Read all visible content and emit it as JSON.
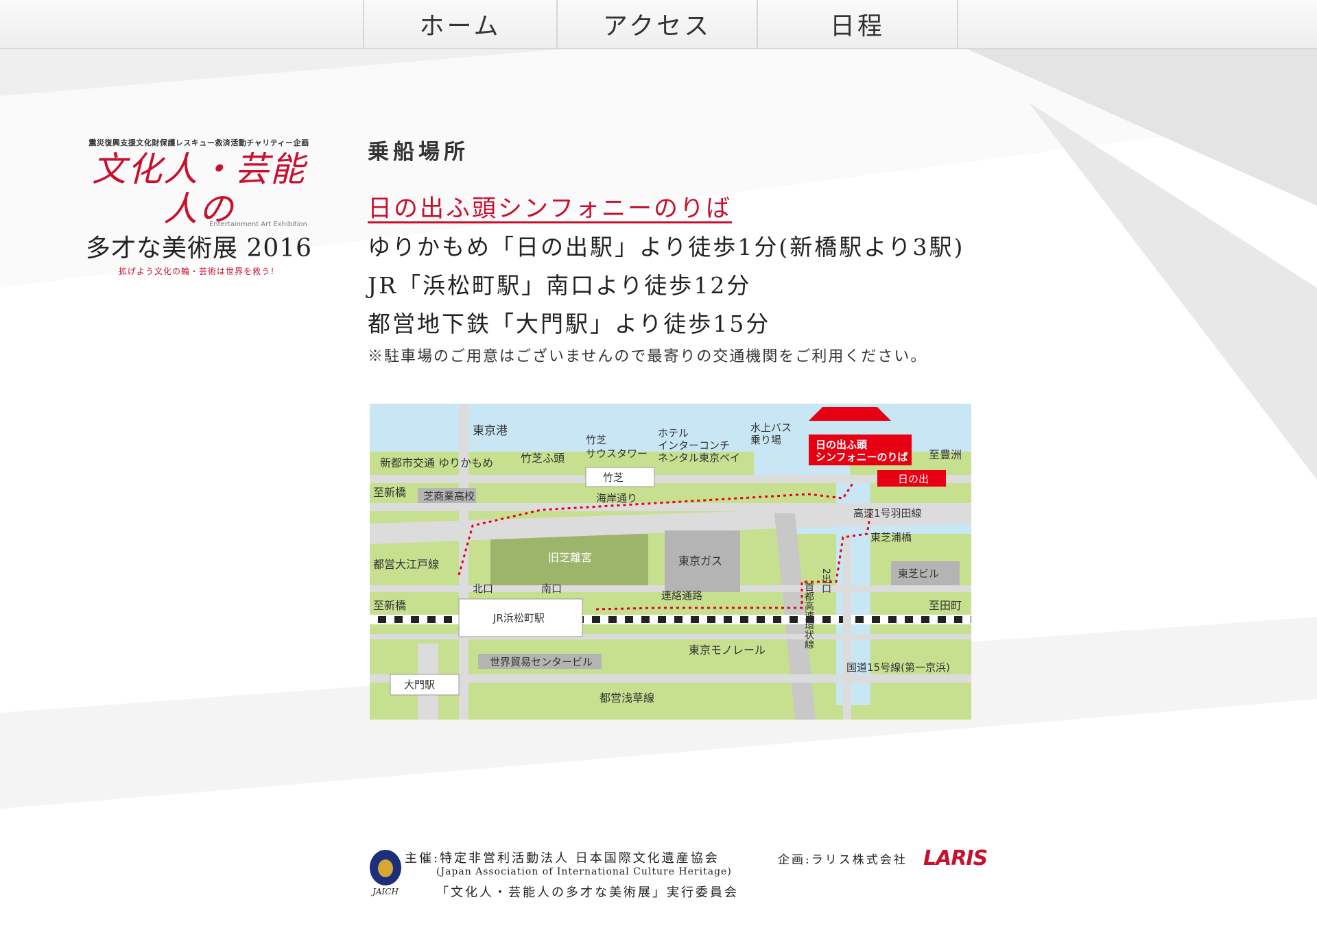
{
  "nav": {
    "items": [
      {
        "label": "ホーム"
      },
      {
        "label": "アクセス"
      },
      {
        "label": "日程"
      }
    ]
  },
  "logo": {
    "pre_title": "震災復興支援文化財保護レスキュー救済活動チャリティー企画",
    "brush_title": "文化人・芸能人の",
    "english": "Entertainment Art Exhibition",
    "main_title": "多才な美術展 2016",
    "tagline": "拡げよう文化の輪・芸術は世界を救う！"
  },
  "content": {
    "heading": "乗船場所",
    "venue": "日の出ふ頭シンフォニーのりば",
    "lines": [
      "ゆりかもめ「日の出駅」より徒歩1分(新橋駅より3駅)",
      "JR「浜松町駅」南口より徒歩12分",
      "都営地下鉄「大門駅」より徒歩15分"
    ],
    "note": "※駐車場のご用意はございませんので最寄りの交通機関をご利用ください。"
  },
  "map": {
    "labels": {
      "tokyo_port": "東京港",
      "yurikamome": "新都市交通 ゆりかもめ",
      "takeshiba_futo": "竹芝ふ頭",
      "takeshiba_tower_1": "竹芝",
      "takeshiba_tower_2": "サウスタワー",
      "hotel_1": "ホテル",
      "hotel_2": "インターコンチ",
      "hotel_3": "ネンタル東京ベイ",
      "water_bus_1": "水上バス",
      "water_bus_2": "乗り場",
      "venue_1": "日の出ふ頭",
      "venue_2": "シンフォニーのりば",
      "to_toyosu": "至豊洲",
      "takeshiba_station": "竹芝",
      "hinode_station": "日の出",
      "to_shinbashi_1": "至新橋",
      "shiba_school": "芝商業高校",
      "kaigan_dori": "海岸通り",
      "shuto_1gou": "高速1号羽田線",
      "toshiba_ura_bridge": "東芝浦橋",
      "oedo_line": "都営大江戸線",
      "kyu_shiba_rikyu": "旧芝離宮",
      "tokyo_gas": "東京ガス",
      "shuto_kanjo": "首都高速環状線",
      "exit_2": "2出口",
      "toshiba_building": "東芝ビル",
      "kitaguchi": "北口",
      "minamiguchi": "南口",
      "renraku_tsuro": "連絡通路",
      "to_shinbashi_2": "至新橋",
      "jr_hamamatsucho": "JR浜松町駅",
      "to_tamachi": "至田町",
      "monorail": "東京モノレール",
      "world_trade_center": "世界貿易センタービル",
      "route15": "国道15号線(第一京浜)",
      "daimon": "大門駅",
      "asakusa_line": "都営浅草線"
    },
    "colors": {
      "water": "#c8e6f4",
      "land": "#c6e08f",
      "road": "#dcdcdc",
      "building": "#b4b4b4",
      "park": "#9db56b",
      "accent": "#e60012"
    }
  },
  "footer": {
    "emblem_caption": "JAICH",
    "organizer": "主催:特定非営利活動法人 日本国際文化遺産協会",
    "organizer_en": "(Japan Association of International Culture Heritage)",
    "committee": "「文化人・芸能人の多才な美術展」実行委員会",
    "planning": "企画:ラリス株式会社",
    "laris_logo": "LARIS"
  }
}
